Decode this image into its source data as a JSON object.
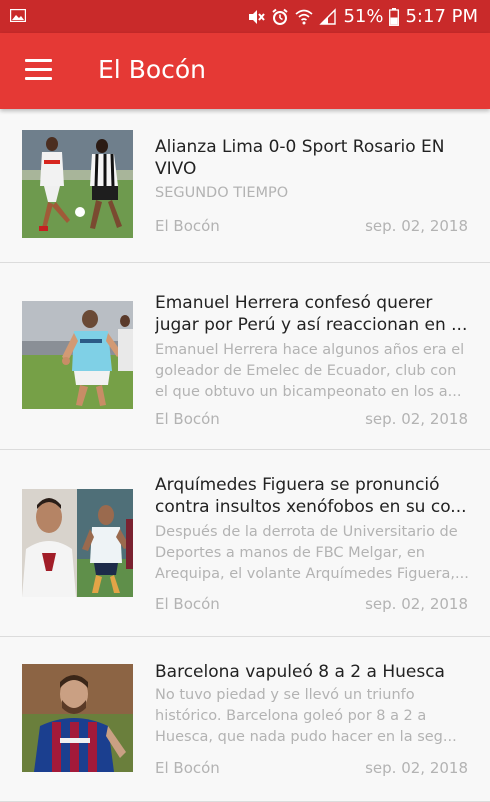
{
  "status_bar": {
    "battery": "51%",
    "time": "5:17 PM",
    "icons": [
      "image-icon",
      "mute-icon",
      "alarm-icon",
      "wifi-icon",
      "signal-icon",
      "battery-icon"
    ]
  },
  "app_bar": {
    "title": "El Bocón",
    "menu_icon": "hamburger-menu-icon",
    "color": "#e53935"
  },
  "articles": [
    {
      "headline": "Alianza Lima 0-0 Sport Rosario EN VIVO",
      "summary": "SEGUNDO TIEMPO",
      "source": "El Bocón",
      "date": "sep. 02, 2018"
    },
    {
      "headline": "Emanuel Herrera confesó querer jugar por Perú y así reaccionan en ...",
      "summary": "Emanuel Herrera hace algunos años era el goleador de Emelec de Ecuador, club con el que obtuvo un bicampeonato en los a...",
      "source": "El Bocón",
      "date": "sep. 02, 2018"
    },
    {
      "headline": "Arquímedes Figuera se pronunció contra insultos xenófobos en su co...",
      "summary": "Después de la derrota de Universitario de Deportes a manos de FBC Melgar, en Arequipa, el volante Arquímedes Figuera,...",
      "source": "El Bocón",
      "date": "sep. 02, 2018"
    },
    {
      "headline": "Barcelona vapuleó 8 a 2 a Huesca",
      "summary": "No tuvo piedad y se llevó un triunfo histórico. Barcelona goleó por 8 a 2 a Huesca, que nada pudo hacer en la seg...",
      "source": "El Bocón",
      "date": "sep. 02, 2018"
    }
  ]
}
